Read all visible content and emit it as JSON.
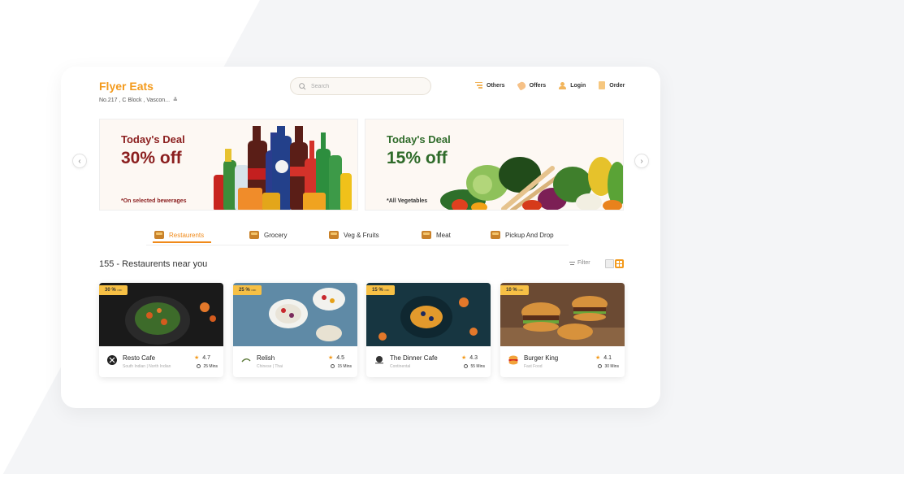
{
  "header": {
    "brand": "Flyer Eats",
    "address": "No.217 , C Block , Vascon...",
    "address_chevron": "≚",
    "search_placeholder": "Search",
    "nav": [
      {
        "label": "Others",
        "icon": "menu-icon"
      },
      {
        "label": "Offers",
        "icon": "tag-icon"
      },
      {
        "label": "Login",
        "icon": "user-icon"
      },
      {
        "label": "Order",
        "icon": "bag-icon"
      }
    ]
  },
  "carousel": {
    "prev_icon": "‹",
    "next_icon": "›",
    "banners": [
      {
        "title": "Today's Deal",
        "discount": "30% off",
        "note": "*On selected bewerages",
        "color": "#8b1e1e"
      },
      {
        "title": "Today's Deal",
        "discount": "15% off",
        "note": "*All Vegetables",
        "color": "#2f6b2a"
      }
    ]
  },
  "tabs": [
    {
      "label": "Restaurents",
      "active": true
    },
    {
      "label": "Grocery",
      "active": false
    },
    {
      "label": "Veg & Fruits",
      "active": false
    },
    {
      "label": "Meat",
      "active": false
    },
    {
      "label": "Pickup And Drop",
      "active": false
    }
  ],
  "listing": {
    "title": "155 - Restaurents near you",
    "filter_label": "Filter"
  },
  "restaurants": [
    {
      "name": "Resto Cafe",
      "cuisine": "South Indian  |  North Indian",
      "rating": "4.7",
      "time": "25 Mins",
      "discount": "30 %",
      "discount_suffix": "OFF"
    },
    {
      "name": "Relish",
      "cuisine": "Chinese  |  Thai",
      "rating": "4.5",
      "time": "15 Mins",
      "discount": "25 %",
      "discount_suffix": "OFF"
    },
    {
      "name": "The Dinner Cafe",
      "cuisine": "Continental",
      "rating": "4.3",
      "time": "55 Mins",
      "discount": "15 %",
      "discount_suffix": "OFF"
    },
    {
      "name": "Burger King",
      "cuisine": "Fast Food",
      "rating": "4.1",
      "time": "30 Mins",
      "discount": "10 %",
      "discount_suffix": "OFF"
    }
  ],
  "colors": {
    "accent": "#f39a1c",
    "badge": "#f7c045"
  }
}
